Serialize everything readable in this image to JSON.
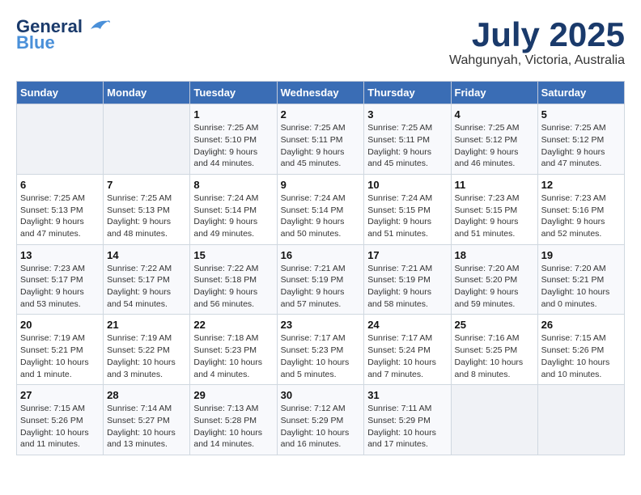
{
  "header": {
    "logo_general": "General",
    "logo_blue": "Blue",
    "month_year": "July 2025",
    "location": "Wahgunyah, Victoria, Australia"
  },
  "weekdays": [
    "Sunday",
    "Monday",
    "Tuesday",
    "Wednesday",
    "Thursday",
    "Friday",
    "Saturday"
  ],
  "weeks": [
    [
      {
        "day": "",
        "detail": ""
      },
      {
        "day": "",
        "detail": ""
      },
      {
        "day": "1",
        "detail": "Sunrise: 7:25 AM\nSunset: 5:10 PM\nDaylight: 9 hours\nand 44 minutes."
      },
      {
        "day": "2",
        "detail": "Sunrise: 7:25 AM\nSunset: 5:11 PM\nDaylight: 9 hours\nand 45 minutes."
      },
      {
        "day": "3",
        "detail": "Sunrise: 7:25 AM\nSunset: 5:11 PM\nDaylight: 9 hours\nand 45 minutes."
      },
      {
        "day": "4",
        "detail": "Sunrise: 7:25 AM\nSunset: 5:12 PM\nDaylight: 9 hours\nand 46 minutes."
      },
      {
        "day": "5",
        "detail": "Sunrise: 7:25 AM\nSunset: 5:12 PM\nDaylight: 9 hours\nand 47 minutes."
      }
    ],
    [
      {
        "day": "6",
        "detail": "Sunrise: 7:25 AM\nSunset: 5:13 PM\nDaylight: 9 hours\nand 47 minutes."
      },
      {
        "day": "7",
        "detail": "Sunrise: 7:25 AM\nSunset: 5:13 PM\nDaylight: 9 hours\nand 48 minutes."
      },
      {
        "day": "8",
        "detail": "Sunrise: 7:24 AM\nSunset: 5:14 PM\nDaylight: 9 hours\nand 49 minutes."
      },
      {
        "day": "9",
        "detail": "Sunrise: 7:24 AM\nSunset: 5:14 PM\nDaylight: 9 hours\nand 50 minutes."
      },
      {
        "day": "10",
        "detail": "Sunrise: 7:24 AM\nSunset: 5:15 PM\nDaylight: 9 hours\nand 51 minutes."
      },
      {
        "day": "11",
        "detail": "Sunrise: 7:23 AM\nSunset: 5:15 PM\nDaylight: 9 hours\nand 51 minutes."
      },
      {
        "day": "12",
        "detail": "Sunrise: 7:23 AM\nSunset: 5:16 PM\nDaylight: 9 hours\nand 52 minutes."
      }
    ],
    [
      {
        "day": "13",
        "detail": "Sunrise: 7:23 AM\nSunset: 5:17 PM\nDaylight: 9 hours\nand 53 minutes."
      },
      {
        "day": "14",
        "detail": "Sunrise: 7:22 AM\nSunset: 5:17 PM\nDaylight: 9 hours\nand 54 minutes."
      },
      {
        "day": "15",
        "detail": "Sunrise: 7:22 AM\nSunset: 5:18 PM\nDaylight: 9 hours\nand 56 minutes."
      },
      {
        "day": "16",
        "detail": "Sunrise: 7:21 AM\nSunset: 5:19 PM\nDaylight: 9 hours\nand 57 minutes."
      },
      {
        "day": "17",
        "detail": "Sunrise: 7:21 AM\nSunset: 5:19 PM\nDaylight: 9 hours\nand 58 minutes."
      },
      {
        "day": "18",
        "detail": "Sunrise: 7:20 AM\nSunset: 5:20 PM\nDaylight: 9 hours\nand 59 minutes."
      },
      {
        "day": "19",
        "detail": "Sunrise: 7:20 AM\nSunset: 5:21 PM\nDaylight: 10 hours\nand 0 minutes."
      }
    ],
    [
      {
        "day": "20",
        "detail": "Sunrise: 7:19 AM\nSunset: 5:21 PM\nDaylight: 10 hours\nand 1 minute."
      },
      {
        "day": "21",
        "detail": "Sunrise: 7:19 AM\nSunset: 5:22 PM\nDaylight: 10 hours\nand 3 minutes."
      },
      {
        "day": "22",
        "detail": "Sunrise: 7:18 AM\nSunset: 5:23 PM\nDaylight: 10 hours\nand 4 minutes."
      },
      {
        "day": "23",
        "detail": "Sunrise: 7:17 AM\nSunset: 5:23 PM\nDaylight: 10 hours\nand 5 minutes."
      },
      {
        "day": "24",
        "detail": "Sunrise: 7:17 AM\nSunset: 5:24 PM\nDaylight: 10 hours\nand 7 minutes."
      },
      {
        "day": "25",
        "detail": "Sunrise: 7:16 AM\nSunset: 5:25 PM\nDaylight: 10 hours\nand 8 minutes."
      },
      {
        "day": "26",
        "detail": "Sunrise: 7:15 AM\nSunset: 5:26 PM\nDaylight: 10 hours\nand 10 minutes."
      }
    ],
    [
      {
        "day": "27",
        "detail": "Sunrise: 7:15 AM\nSunset: 5:26 PM\nDaylight: 10 hours\nand 11 minutes."
      },
      {
        "day": "28",
        "detail": "Sunrise: 7:14 AM\nSunset: 5:27 PM\nDaylight: 10 hours\nand 13 minutes."
      },
      {
        "day": "29",
        "detail": "Sunrise: 7:13 AM\nSunset: 5:28 PM\nDaylight: 10 hours\nand 14 minutes."
      },
      {
        "day": "30",
        "detail": "Sunrise: 7:12 AM\nSunset: 5:29 PM\nDaylight: 10 hours\nand 16 minutes."
      },
      {
        "day": "31",
        "detail": "Sunrise: 7:11 AM\nSunset: 5:29 PM\nDaylight: 10 hours\nand 17 minutes."
      },
      {
        "day": "",
        "detail": ""
      },
      {
        "day": "",
        "detail": ""
      }
    ]
  ]
}
